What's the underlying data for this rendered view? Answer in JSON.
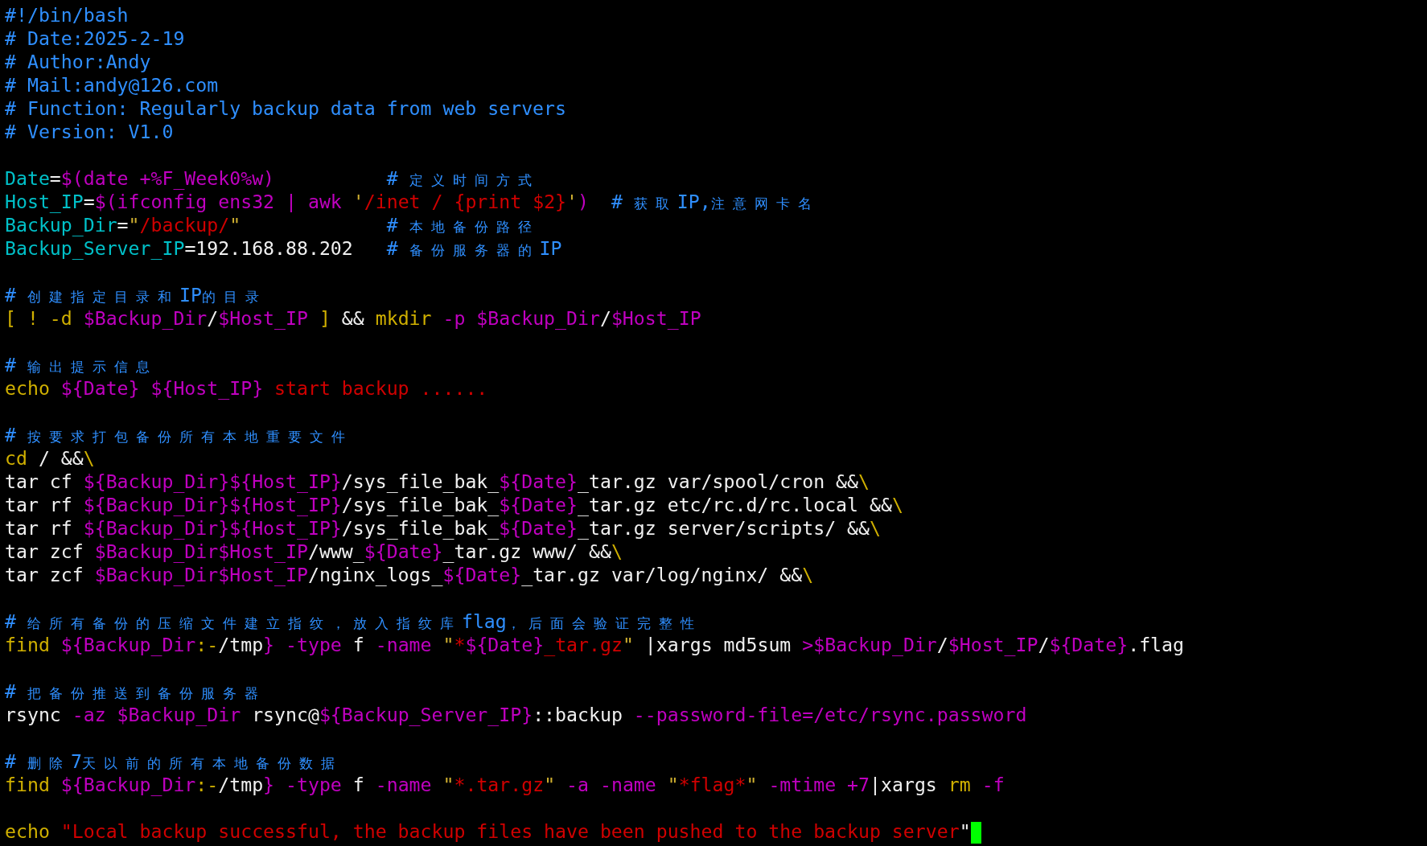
{
  "blocks": [
    {
      "lines": [
        {
          "segments": [
            {
              "kind": "comment",
              "text": "#!/bin/bash"
            }
          ]
        },
        {
          "segments": [
            {
              "kind": "comment",
              "text": "# Date:2025-2-19"
            }
          ]
        },
        {
          "segments": [
            {
              "kind": "comment",
              "text": "# Author:Andy"
            }
          ]
        },
        {
          "segments": [
            {
              "kind": "comment",
              "text": "# Mail:andy@126.com"
            }
          ]
        },
        {
          "segments": [
            {
              "kind": "comment",
              "text": "# Function: Regularly backup data from web servers"
            }
          ]
        },
        {
          "segments": [
            {
              "kind": "comment",
              "text": "# Version: V1.0"
            }
          ]
        }
      ]
    },
    {
      "lines": [
        {
          "segments": [
            {
              "kind": "var",
              "text": "Date"
            },
            {
              "kind": "plain",
              "text": "="
            },
            {
              "kind": "subst",
              "text": "$(date +%F_Week0%w)"
            },
            {
              "kind": "comment",
              "text": "          # "
            },
            {
              "kind": "cjk",
              "text": "定义时间方式"
            }
          ]
        },
        {
          "segments": [
            {
              "kind": "var",
              "text": "Host_IP"
            },
            {
              "kind": "plain",
              "text": "="
            },
            {
              "kind": "subst",
              "text": "$(ifconfig ens32 | awk "
            },
            {
              "kind": "quote",
              "text": "'"
            },
            {
              "kind": "string",
              "text": "/inet / {print $2}"
            },
            {
              "kind": "quote",
              "text": "'"
            },
            {
              "kind": "subst",
              "text": ")"
            },
            {
              "kind": "comment",
              "text": "  # "
            },
            {
              "kind": "cjk",
              "text": "获取"
            },
            {
              "kind": "comment",
              "text": "IP,"
            },
            {
              "kind": "cjk",
              "text": "注意网卡名"
            }
          ]
        },
        {
          "segments": [
            {
              "kind": "var",
              "text": "Backup_Dir"
            },
            {
              "kind": "plain",
              "text": "="
            },
            {
              "kind": "quote",
              "text": "\""
            },
            {
              "kind": "string",
              "text": "/backup/"
            },
            {
              "kind": "quote",
              "text": "\""
            },
            {
              "kind": "comment",
              "text": "             # "
            },
            {
              "kind": "cjk",
              "text": "本地备份路径"
            }
          ]
        },
        {
          "segments": [
            {
              "kind": "var",
              "text": "Backup_Server_IP"
            },
            {
              "kind": "plain",
              "text": "=192.168.88.202   "
            },
            {
              "kind": "comment",
              "text": "# "
            },
            {
              "kind": "cjk",
              "text": "备份服务器的"
            },
            {
              "kind": "comment",
              "text": "IP"
            }
          ]
        }
      ]
    },
    {
      "lines": [
        {
          "segments": [
            {
              "kind": "comment",
              "text": "# "
            },
            {
              "kind": "cjk",
              "text": "创建指定目录和"
            },
            {
              "kind": "comment",
              "text": "IP"
            },
            {
              "kind": "cjk",
              "text": "的目录"
            }
          ]
        },
        {
          "segments": [
            {
              "kind": "keyword",
              "text": "[ ! -d "
            },
            {
              "kind": "subst",
              "text": "$Backup_Dir"
            },
            {
              "kind": "plain",
              "text": "/"
            },
            {
              "kind": "subst",
              "text": "$Host_IP"
            },
            {
              "kind": "keyword",
              "text": " ]"
            },
            {
              "kind": "plain",
              "text": " && "
            },
            {
              "kind": "keyword",
              "text": "mkdir "
            },
            {
              "kind": "subst",
              "text": "-p $Backup_Dir"
            },
            {
              "kind": "plain",
              "text": "/"
            },
            {
              "kind": "subst",
              "text": "$Host_IP"
            }
          ]
        }
      ]
    },
    {
      "lines": [
        {
          "segments": [
            {
              "kind": "comment",
              "text": "# "
            },
            {
              "kind": "cjk",
              "text": "输出提示信息"
            }
          ]
        },
        {
          "segments": [
            {
              "kind": "keyword",
              "text": "echo "
            },
            {
              "kind": "subst",
              "text": "${Date} ${Host_IP} "
            },
            {
              "kind": "string",
              "text": "start backup ......"
            }
          ]
        }
      ]
    },
    {
      "lines": [
        {
          "segments": [
            {
              "kind": "comment",
              "text": "# "
            },
            {
              "kind": "cjk",
              "text": "按要求打包备份所有本地重要文件"
            }
          ]
        },
        {
          "segments": [
            {
              "kind": "keyword",
              "text": "cd"
            },
            {
              "kind": "plain",
              "text": " / &&"
            },
            {
              "kind": "keyword",
              "text": "\\"
            }
          ]
        },
        {
          "segments": [
            {
              "kind": "plain",
              "text": "tar cf "
            },
            {
              "kind": "subst",
              "text": "${Backup_Dir}${Host_IP}"
            },
            {
              "kind": "plain",
              "text": "/sys_file_bak_"
            },
            {
              "kind": "subst",
              "text": "${Date}"
            },
            {
              "kind": "plain",
              "text": "_tar.gz var/spool/cron &&"
            },
            {
              "kind": "keyword",
              "text": "\\"
            }
          ]
        },
        {
          "segments": [
            {
              "kind": "plain",
              "text": "tar rf "
            },
            {
              "kind": "subst",
              "text": "${Backup_Dir}${Host_IP}"
            },
            {
              "kind": "plain",
              "text": "/sys_file_bak_"
            },
            {
              "kind": "subst",
              "text": "${Date}"
            },
            {
              "kind": "plain",
              "text": "_tar.gz etc/rc.d/rc.local &&"
            },
            {
              "kind": "keyword",
              "text": "\\"
            }
          ]
        },
        {
          "segments": [
            {
              "kind": "plain",
              "text": "tar rf "
            },
            {
              "kind": "subst",
              "text": "${Backup_Dir}${Host_IP}"
            },
            {
              "kind": "plain",
              "text": "/sys_file_bak_"
            },
            {
              "kind": "subst",
              "text": "${Date}"
            },
            {
              "kind": "plain",
              "text": "_tar.gz server/scripts/ &&"
            },
            {
              "kind": "keyword",
              "text": "\\"
            }
          ]
        },
        {
          "segments": [
            {
              "kind": "plain",
              "text": "tar zcf "
            },
            {
              "kind": "subst",
              "text": "$Backup_Dir$Host_IP"
            },
            {
              "kind": "plain",
              "text": "/www_"
            },
            {
              "kind": "subst",
              "text": "${Date}"
            },
            {
              "kind": "plain",
              "text": "_tar.gz www/ &&"
            },
            {
              "kind": "keyword",
              "text": "\\"
            }
          ]
        },
        {
          "segments": [
            {
              "kind": "plain",
              "text": "tar zcf "
            },
            {
              "kind": "subst",
              "text": "$Backup_Dir$Host_IP"
            },
            {
              "kind": "plain",
              "text": "/nginx_logs_"
            },
            {
              "kind": "subst",
              "text": "${Date}"
            },
            {
              "kind": "plain",
              "text": "_tar.gz var/log/nginx/ &&"
            },
            {
              "kind": "keyword",
              "text": "\\"
            }
          ]
        }
      ]
    },
    {
      "lines": [
        {
          "segments": [
            {
              "kind": "comment",
              "text": "# "
            },
            {
              "kind": "cjk",
              "text": "给所有备份的压缩文件建立指纹，放入指纹库"
            },
            {
              "kind": "comment",
              "text": "flag"
            },
            {
              "kind": "cjk",
              "text": "，后面会验证完整性"
            }
          ]
        },
        {
          "segments": [
            {
              "kind": "keyword",
              "text": "find "
            },
            {
              "kind": "subst",
              "text": "${Backup_Dir"
            },
            {
              "kind": "keyword",
              "text": ":-"
            },
            {
              "kind": "plain",
              "text": "/tmp"
            },
            {
              "kind": "subst",
              "text": "} -type"
            },
            {
              "kind": "plain",
              "text": " f "
            },
            {
              "kind": "subst",
              "text": "-name "
            },
            {
              "kind": "quote",
              "text": "\""
            },
            {
              "kind": "string",
              "text": "*"
            },
            {
              "kind": "subst",
              "text": "${Date}"
            },
            {
              "kind": "string",
              "text": "_tar.gz"
            },
            {
              "kind": "quote",
              "text": "\""
            },
            {
              "kind": "plain",
              "text": " |xargs md5sum "
            },
            {
              "kind": "subst",
              "text": ">$Backup_Dir"
            },
            {
              "kind": "plain",
              "text": "/"
            },
            {
              "kind": "subst",
              "text": "$Host_IP"
            },
            {
              "kind": "plain",
              "text": "/"
            },
            {
              "kind": "subst",
              "text": "${Date}"
            },
            {
              "kind": "plain",
              "text": ".flag"
            }
          ]
        }
      ]
    },
    {
      "lines": [
        {
          "segments": [
            {
              "kind": "comment",
              "text": "# "
            },
            {
              "kind": "cjk",
              "text": "把备份推送到备份服务器"
            }
          ]
        },
        {
          "segments": [
            {
              "kind": "plain",
              "text": "rsync "
            },
            {
              "kind": "subst",
              "text": "-az $Backup_Dir"
            },
            {
              "kind": "plain",
              "text": " rsync@"
            },
            {
              "kind": "subst",
              "text": "${Backup_Server_IP}"
            },
            {
              "kind": "plain",
              "text": "::backup "
            },
            {
              "kind": "subst",
              "text": "--password-file=/etc/rsync.password"
            }
          ]
        }
      ]
    },
    {
      "lines": [
        {
          "segments": [
            {
              "kind": "comment",
              "text": "# "
            },
            {
              "kind": "cjk",
              "text": "删除"
            },
            {
              "kind": "comment",
              "text": "7"
            },
            {
              "kind": "cjk",
              "text": "天以前的所有本地备份数据"
            }
          ]
        },
        {
          "segments": [
            {
              "kind": "keyword",
              "text": "find "
            },
            {
              "kind": "subst",
              "text": "${Backup_Dir"
            },
            {
              "kind": "keyword",
              "text": ":-"
            },
            {
              "kind": "plain",
              "text": "/tmp"
            },
            {
              "kind": "subst",
              "text": "} -type"
            },
            {
              "kind": "plain",
              "text": " f "
            },
            {
              "kind": "subst",
              "text": "-name "
            },
            {
              "kind": "quote",
              "text": "\""
            },
            {
              "kind": "string",
              "text": "*.tar.gz"
            },
            {
              "kind": "quote",
              "text": "\""
            },
            {
              "kind": "subst",
              "text": " -a -name "
            },
            {
              "kind": "quote",
              "text": "\""
            },
            {
              "kind": "string",
              "text": "*flag*"
            },
            {
              "kind": "quote",
              "text": "\""
            },
            {
              "kind": "subst",
              "text": " -mtime +7"
            },
            {
              "kind": "plain",
              "text": "|xargs "
            },
            {
              "kind": "keyword",
              "text": "rm "
            },
            {
              "kind": "subst",
              "text": "-f"
            }
          ]
        }
      ]
    },
    {
      "lines": [
        {
          "segments": [
            {
              "kind": "keyword",
              "text": "echo "
            },
            {
              "kind": "string",
              "text": "\"Local backup successful, the backup files have been pushed to the backup server"
            },
            {
              "kind": "plain",
              "text": "\""
            }
          ],
          "cursor": true
        }
      ]
    }
  ]
}
